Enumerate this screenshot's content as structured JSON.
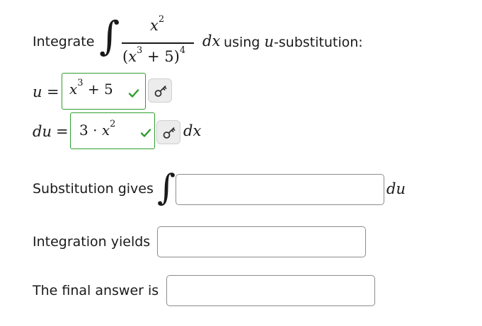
{
  "prompt": {
    "label": "Integrate",
    "numerator_base": "x",
    "numerator_exp": "2",
    "denominator_lparen": "(",
    "denominator_base": "x",
    "denominator_inner_exp": "3",
    "denominator_plus": "+ 5)",
    "denominator_outer_exp": "4",
    "dx": "dx",
    "suffix_pre": "using",
    "suffix_var": "u",
    "suffix_post": "-substitution:"
  },
  "u_row": {
    "var": "u",
    "equals": "=",
    "answer_base": "x",
    "answer_exp": "3",
    "answer_rest": "+ 5",
    "status": "correct"
  },
  "du_row": {
    "var": "du",
    "equals": "=",
    "answer_coef": "3 ·",
    "answer_base": "x",
    "answer_exp": "2",
    "suffix": "dx",
    "status": "correct"
  },
  "substitution": {
    "label": "Substitution gives",
    "value": "",
    "suffix": "du"
  },
  "integration": {
    "label": "Integration yields",
    "value": ""
  },
  "final": {
    "label": "The final answer is",
    "value": ""
  },
  "colors": {
    "correct": "#2e9d2e",
    "text": "#1a1a1a",
    "button_bg": "#ececec"
  },
  "icons": [
    "integral-icon",
    "checkmark-icon",
    "key-icon"
  ]
}
